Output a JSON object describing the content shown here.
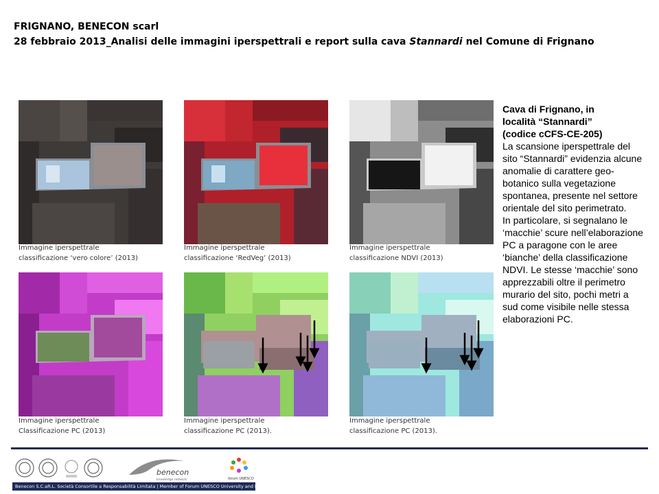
{
  "header": {
    "line1": "FRIGNANO, BENECON scarl",
    "line2_pre": "28 febbraio 2013_Analisi delle immagini iperspettrali e report sulla cava ",
    "line2_italic": "Stannardi",
    "line2_post": " nel Comune di Frignano"
  },
  "images": [
    {
      "caption_1": "Immagine iperspettrale",
      "caption_2": "classificazione ‘vero colore’ (2013)"
    },
    {
      "caption_1": "Immagine iperspettrale",
      "caption_2": "classificazione ‘RedVeg’ (2013)"
    },
    {
      "caption_1": "Immagine iperspettrale",
      "caption_2": "classificazione NDVI (2013)"
    },
    {
      "caption_1": "Immagine iperspettrale",
      "caption_2": "Classificazione PC (2013)"
    },
    {
      "caption_1": "Immagine iperspettrale",
      "caption_2": "classificazione PC (2013)."
    },
    {
      "caption_1": "Immagine iperspettrale",
      "caption_2": "classificazione PC (2013)."
    }
  ],
  "side": {
    "title_1": "Cava di Frignano, in",
    "title_2": "località “Stannardi”",
    "title_3": "(codice cCFS-CE-205)",
    "paragraph_1": "La scansione iperspettrale del sito “Stannardi” evidenzia alcune anomalie di carattere geo-botanico sulla vegetazione spontanea, presente nel settore orientale del sito perimetrato.",
    "paragraph_2": "In particolare, si segnalano le ‘macchie’ scure nell’elaborazione PC a paragone con le aree ‘bianche’ della classificazione NDVI. Le stesse ‘macchie’ sono apprezzabili oltre il perimetro murario del sito, pochi metri a sud come visibile nelle stessa elaborazioni PC."
  },
  "footer": {
    "logo_text": "benecon",
    "logo_sub": "knowledge network",
    "unesco_text": "forum UNESCO",
    "bar_text": "Benecon S.C.aR.L. Società Consortile a Responsabilità Limitata | Member of Forum UNESCO University and Heritage"
  },
  "colors": {
    "rule": "#1f2a56"
  }
}
